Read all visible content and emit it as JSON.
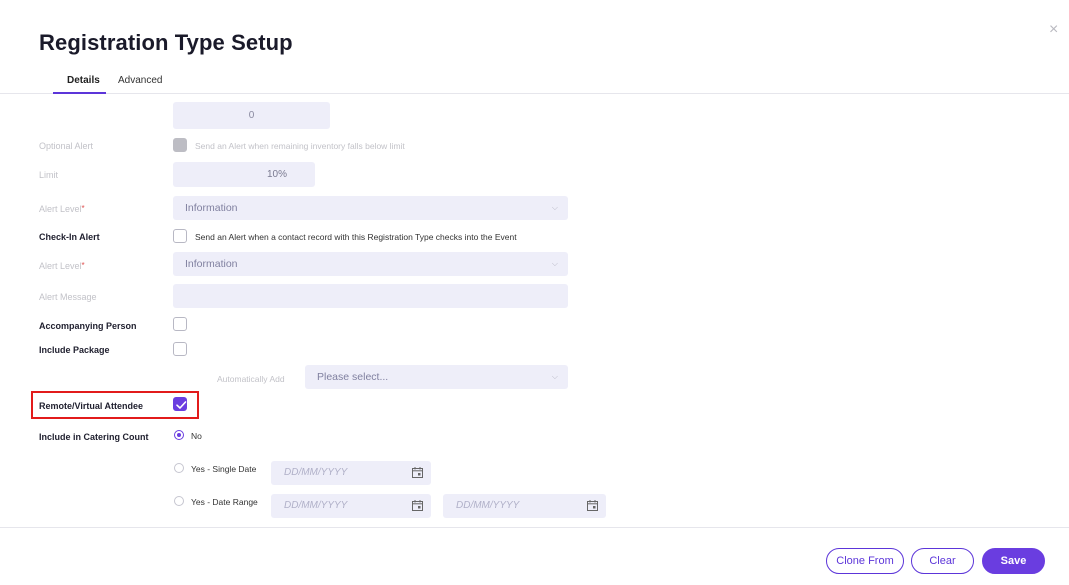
{
  "modal": {
    "title": "Registration Type Setup",
    "close_label": "×"
  },
  "tabs": [
    {
      "label": "Details",
      "active": true
    },
    {
      "label": "Advanced",
      "active": false
    }
  ],
  "form": {
    "inventory_value": "0",
    "optional_alert": {
      "label": "Optional Alert",
      "checkbox_text": "Send an Alert when remaining inventory falls below limit",
      "checked": false
    },
    "limit": {
      "label": "Limit",
      "value": "10%"
    },
    "alert_level_1": {
      "label": "Alert Level",
      "required_mark": "*",
      "value": "Information"
    },
    "checkin_alert": {
      "label": "Check-In Alert",
      "checkbox_text": "Send an Alert when a contact record with this Registration Type checks into the Event",
      "checked": false
    },
    "alert_level_2": {
      "label": "Alert Level",
      "required_mark": "*",
      "value": "Information"
    },
    "alert_message": {
      "label": "Alert Message",
      "value": ""
    },
    "accompanying_person": {
      "label": "Accompanying Person",
      "checked": false
    },
    "include_package": {
      "label": "Include Package",
      "checked": false
    },
    "automatically_add": {
      "label": "Automatically Add",
      "value": "Please select..."
    },
    "remote_virtual": {
      "label": "Remote/Virtual Attendee",
      "checked": true
    },
    "catering": {
      "label": "Include in Catering Count",
      "options": [
        {
          "label": "No",
          "selected": true
        },
        {
          "label": "Yes - Single Date",
          "selected": false
        },
        {
          "label": "Yes - Date Range",
          "selected": false
        }
      ],
      "date_placeholder": "DD/MM/YYYY"
    }
  },
  "footer": {
    "clone_label": "Clone From",
    "clear_label": "Clear",
    "save_label": "Save"
  },
  "colors": {
    "accent": "#6a3de0",
    "highlight": "#e21b1b",
    "field_bg": "#eeeef9"
  }
}
